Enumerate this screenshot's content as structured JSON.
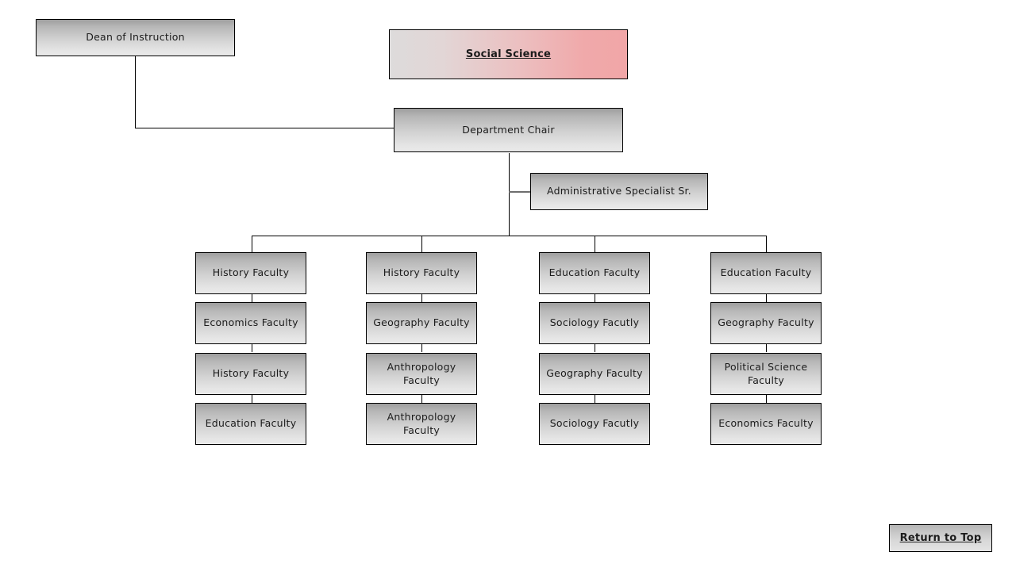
{
  "page": {
    "title": "Social Science",
    "background_color": "#ffffff"
  },
  "colors": {
    "box_border": "#000000",
    "box_gradient_top": "#9e9e9e",
    "box_gradient_bottom": "#e9e9e9",
    "title_gradient_left": "#dddbdb",
    "title_gradient_right": "#f1a6a7",
    "connector": "#000000",
    "text": "#1c1c1c"
  },
  "nodes": {
    "dean": {
      "label": "Dean of Instruction"
    },
    "title": {
      "label": "Social Science"
    },
    "chair": {
      "label": "Department Chair"
    },
    "admin": {
      "label": "Administrative Specialist Sr."
    },
    "return_to_top": {
      "label": "Return to Top"
    }
  },
  "columns": [
    {
      "name": "column-1",
      "items": [
        {
          "label": "History Faculty"
        },
        {
          "label": "Economics Faculty"
        },
        {
          "label": "History Faculty"
        },
        {
          "label": "Education Faculty"
        }
      ]
    },
    {
      "name": "column-2",
      "items": [
        {
          "label": "History Faculty"
        },
        {
          "label": "Geography Faculty"
        },
        {
          "label": "Anthropology Faculty"
        },
        {
          "label": "Anthropology Faculty"
        }
      ]
    },
    {
      "name": "column-3",
      "items": [
        {
          "label": "Education Faculty"
        },
        {
          "label": "Sociology Facutly"
        },
        {
          "label": "Geography Faculty"
        },
        {
          "label": "Sociology Facutly"
        }
      ]
    },
    {
      "name": "column-4",
      "items": [
        {
          "label": "Education Faculty"
        },
        {
          "label": "Geography Faculty"
        },
        {
          "label": "Political Science Faculty"
        },
        {
          "label": "Economics Faculty"
        }
      ]
    }
  ]
}
